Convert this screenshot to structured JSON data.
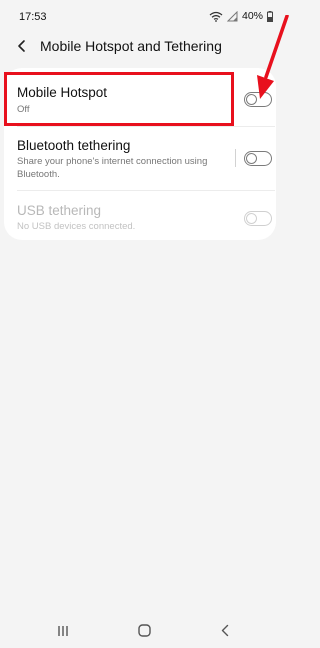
{
  "status_bar": {
    "time": "17:53",
    "battery_percent": "40%",
    "icons": [
      "wifi-icon",
      "signal-icon",
      "battery-icon"
    ]
  },
  "header": {
    "back_icon": "back-arrow-icon",
    "title": "Mobile Hotspot and Tethering"
  },
  "settings": {
    "items": [
      {
        "title": "Mobile Hotspot",
        "subtitle": "Off",
        "enabled": true,
        "on": false
      },
      {
        "title": "Bluetooth tethering",
        "subtitle": "Share your phone's internet connection using Bluetooth.",
        "enabled": true,
        "on": false
      },
      {
        "title": "USB tethering",
        "subtitle": "No USB devices connected.",
        "enabled": false,
        "on": false
      }
    ]
  },
  "annotation": {
    "highlight_color": "#e8101d"
  },
  "nav_bar": {
    "icons": [
      "recent-apps-icon",
      "home-icon",
      "back-icon"
    ]
  }
}
